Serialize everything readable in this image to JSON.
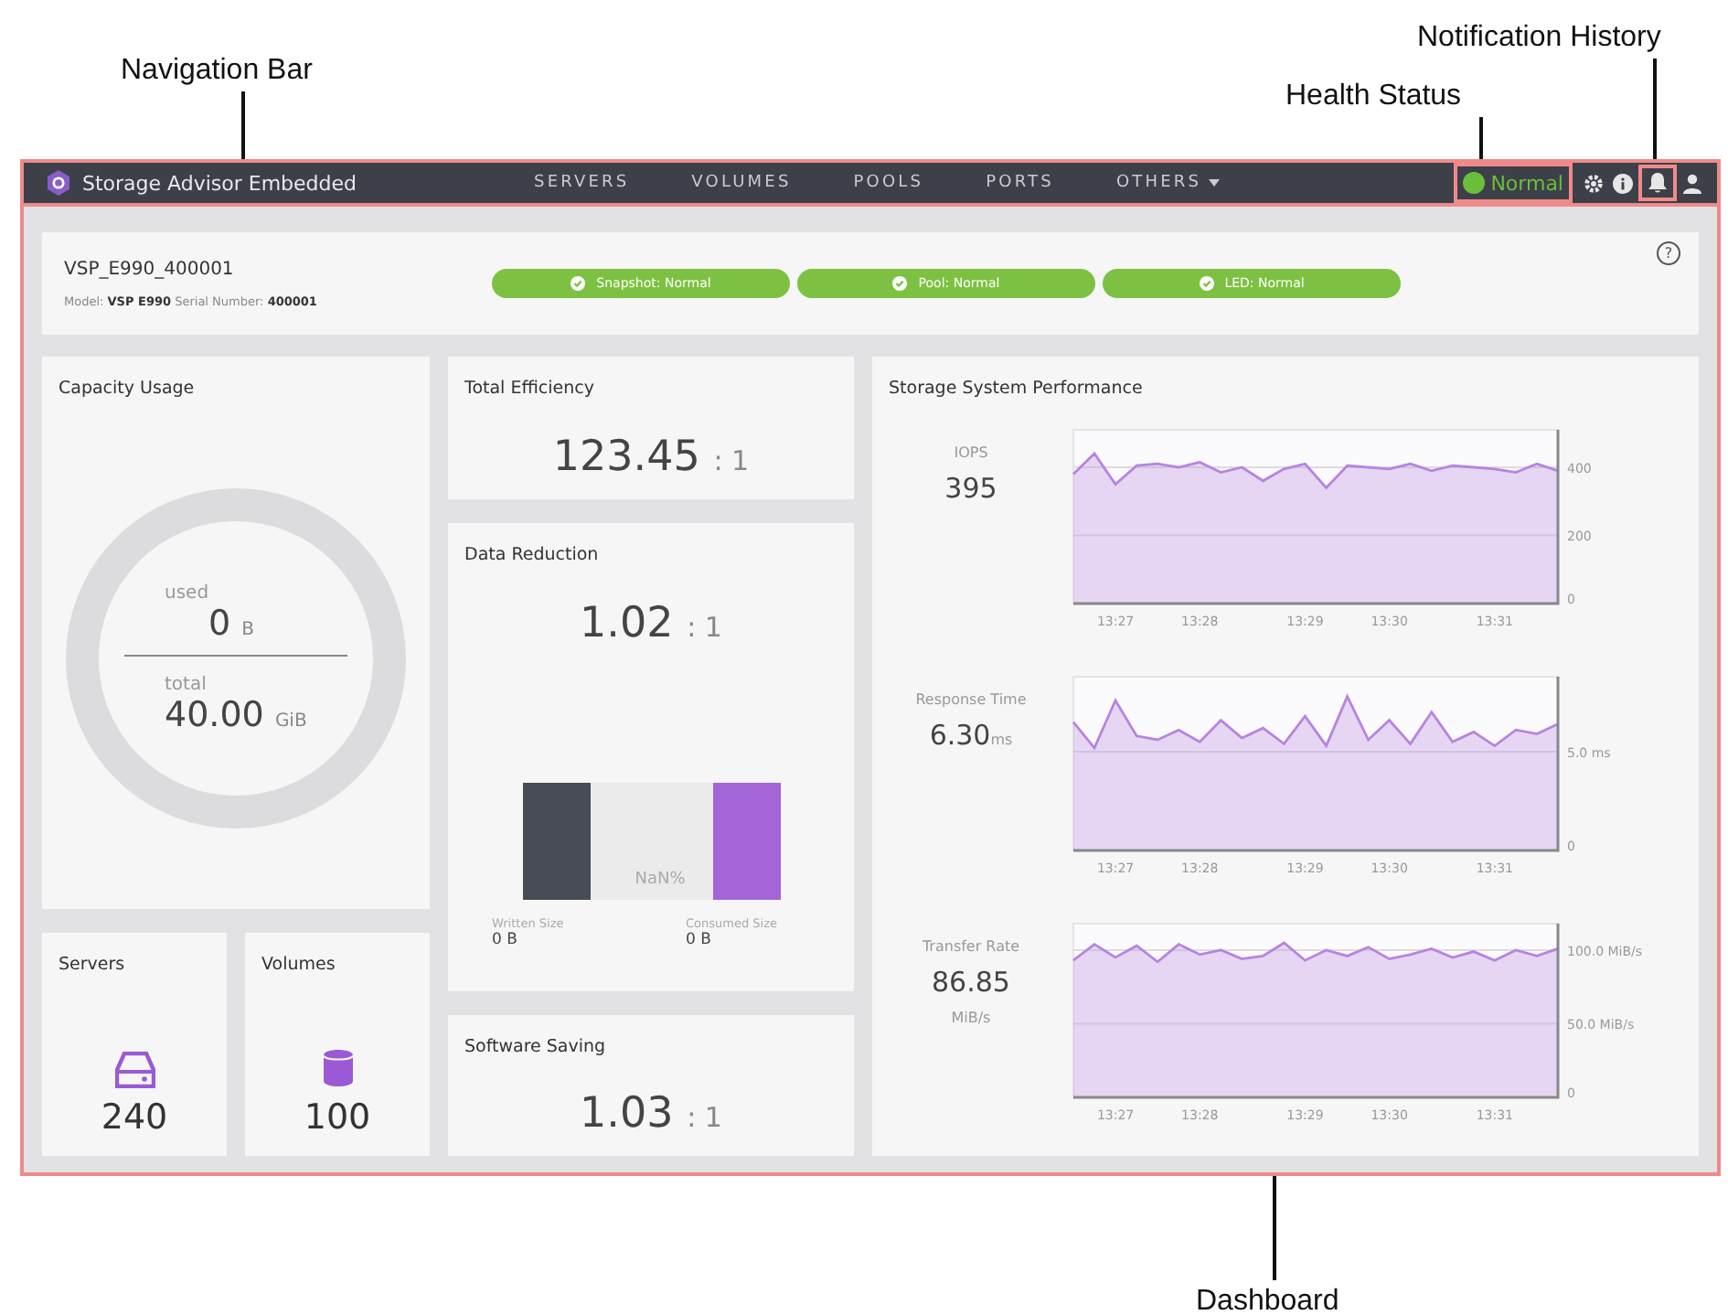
{
  "callouts": [
    {
      "text": "Navigation Bar",
      "kind": "nav"
    },
    {
      "text": "Health Status",
      "kind": "health"
    },
    {
      "text": "Notification History",
      "kind": "bell"
    },
    {
      "text": "Dashboard",
      "kind": "dash"
    }
  ],
  "nav": {
    "title": "Storage Advisor Embedded",
    "links": [
      {
        "label": "SERVERS",
        "dropdown": false
      },
      {
        "label": "VOLUMES",
        "dropdown": false
      },
      {
        "label": "POOLS",
        "dropdown": false
      },
      {
        "label": "PORTS",
        "dropdown": false
      },
      {
        "label": "OTHERS",
        "dropdown": true
      }
    ],
    "health": {
      "label": "Normal",
      "color": "#6abf3a"
    }
  },
  "system": {
    "help": "?",
    "name": "VSP_E990_400001",
    "details": "Model: **VSP E990** Serial Number: **400001**",
    "badges": [
      {
        "label": "Snapshot: Normal",
        "color": "#7dc142"
      },
      {
        "label": "Pool: Normal",
        "color": "#7dc142"
      },
      {
        "label": "LED: Normal",
        "color": "#7dc142"
      }
    ]
  },
  "capacity": {
    "title": "Capacity Usage",
    "used_label": "used",
    "used_value": "0",
    "used_unit": "B",
    "total_label": "total",
    "total_value": "40.00",
    "total_unit": "GiB"
  },
  "servers": {
    "title": "Servers",
    "count": "240"
  },
  "volumes": {
    "title": "Volumes",
    "count": "100"
  },
  "total_efficiency": {
    "title": "Total Efficiency",
    "ratio": "123.45",
    "suffix": ": 1"
  },
  "data_reduction": {
    "title": "Data Reduction",
    "ratio": "1.02",
    "suffix": ": 1",
    "percent": "NaN%",
    "written_label": "Written Size",
    "written_value": "0 B",
    "consumed_label": "Consumed Size",
    "consumed_value": "0 B"
  },
  "software_saving": {
    "title": "Software Saving",
    "ratio": "1.03",
    "suffix": ": 1"
  },
  "performance": {
    "title": "Storage System Performance",
    "metrics": [
      {
        "label": "IOPS",
        "value": "395",
        "chart_data": {
          "type": "area",
          "categories": [
            null,
            null,
            "13:27",
            null,
            null,
            null,
            "13:28",
            null,
            null,
            null,
            null,
            "13:29",
            null,
            null,
            null,
            "13:30",
            null,
            null,
            null,
            null,
            "13:31",
            null,
            null,
            null
          ],
          "series": [
            {
              "color": "#b784e0",
              "values": [
                380,
                440,
                350,
                405,
                410,
                400,
                415,
                385,
                400,
                360,
                395,
                410,
                340,
                405,
                400,
                395,
                410,
                390,
                405,
                400,
                395,
                385,
                410,
                390
              ]
            }
          ],
          "ylim": [
            0,
            510
          ],
          "yticks": [
            0,
            200,
            400
          ]
        }
      },
      {
        "label": "Response Time",
        "value": "6.30",
        "unit": "ms",
        "unit_below": false,
        "chart_data": {
          "type": "area",
          "categories": [
            null,
            null,
            "13:27",
            null,
            null,
            null,
            "13:28",
            null,
            null,
            null,
            null,
            "13:29",
            null,
            null,
            null,
            "13:30",
            null,
            null,
            null,
            null,
            "13:31",
            null,
            null,
            null
          ],
          "series": [
            {
              "color": "#b784e0",
              "values": [
                6.5,
                5.2,
                7.6,
                5.8,
                5.6,
                6.1,
                5.5,
                6.6,
                5.7,
                6.2,
                5.4,
                6.8,
                5.3,
                7.8,
                5.6,
                6.6,
                5.4,
                7.0,
                5.5,
                6.0,
                5.3,
                6.1,
                5.9,
                6.4
              ]
            }
          ],
          "ylim": [
            0,
            8.8
          ],
          "yticks": [
            0,
            {
              "value": 5,
              "label": "5.0 ms"
            }
          ]
        }
      },
      {
        "label": "Transfer Rate",
        "value": "86.85",
        "unit": "MiB/s",
        "unit_below": true,
        "chart_data": {
          "type": "area",
          "categories": [
            null,
            null,
            "13:27",
            null,
            null,
            null,
            "13:28",
            null,
            null,
            null,
            null,
            "13:29",
            null,
            null,
            null,
            "13:30",
            null,
            null,
            null,
            null,
            "13:31",
            null,
            null,
            null
          ],
          "series": [
            {
              "color": "#b784e0",
              "values": [
                93,
                104,
                95,
                103,
                92,
                104,
                97,
                100,
                94,
                96,
                105,
                93,
                100,
                96,
                102,
                94,
                97,
                101,
                95,
                99,
                93,
                100,
                96,
                101
              ]
            }
          ],
          "ylim": [
            0,
            118
          ],
          "yticks": [
            0,
            {
              "value": 50,
              "label": "50.0 MiB/s"
            },
            {
              "value": 100,
              "label": "100.0 MiB/s"
            }
          ]
        }
      }
    ]
  }
}
